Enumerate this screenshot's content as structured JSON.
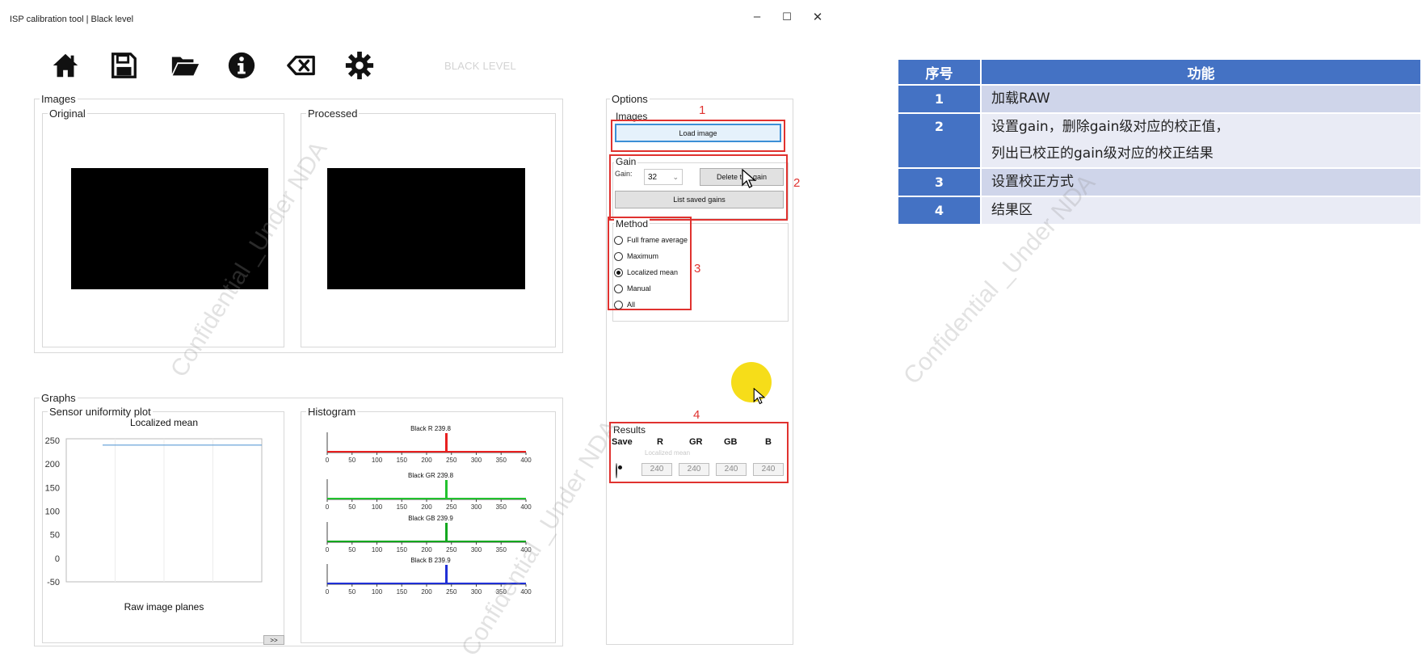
{
  "window": {
    "title": "ISP calibration tool | Black level",
    "minimize_glyph": "–",
    "maximize_glyph": "☐",
    "close_glyph": "✕"
  },
  "toolbar": {
    "icons": [
      "home-icon",
      "save-icon",
      "folder-open-icon",
      "info-icon",
      "backspace-icon",
      "gear-icon"
    ],
    "section_label": "BLACK LEVEL"
  },
  "images": {
    "legend": "Images",
    "original_legend": "Original",
    "processed_legend": "Processed"
  },
  "graphs": {
    "legend": "Graphs",
    "sensor_legend": "Sensor uniformity plot",
    "histogram_legend": "Histogram",
    "expand_button": ">>"
  },
  "options": {
    "legend": "Options",
    "images_legend": "Images",
    "load_image": "Load image",
    "gain_legend": "Gain",
    "gain_label": "Gain:",
    "gain_value": "32",
    "delete_gain": "Delete this gain",
    "list_saved_gains": "List saved gains",
    "method_legend": "Method",
    "methods": [
      {
        "label": "Full frame average",
        "selected": false
      },
      {
        "label": "Maximum",
        "selected": false
      },
      {
        "label": "Localized mean",
        "selected": true
      },
      {
        "label": "Manual",
        "selected": false
      },
      {
        "label": "All",
        "selected": false
      }
    ],
    "results_legend": "Results",
    "results_headers": [
      "Save",
      "R",
      "GR",
      "GB",
      "B"
    ],
    "results_method": "Localized mean",
    "results_values": [
      "240",
      "240",
      "240",
      "240"
    ],
    "save_selected": true
  },
  "annotations": [
    "1",
    "2",
    "3",
    "4"
  ],
  "table": {
    "headers": [
      "序号",
      "功能"
    ],
    "rows": [
      {
        "num": "1",
        "lines": [
          "加载RAW"
        ]
      },
      {
        "num": "2",
        "lines": [
          "设置gain，删除gain级对应的校正值，",
          "列出已校正的gain级对应的校正结果"
        ]
      },
      {
        "num": "3",
        "lines": [
          "设置校正方式"
        ]
      },
      {
        "num": "4",
        "lines": [
          "结果区"
        ]
      }
    ]
  },
  "watermark_text": "Confidential _Under NDA",
  "colors": {
    "accent_red": "#e0322f",
    "table_header": "#4472c4",
    "hist_r": "#e81f1f",
    "hist_gr": "#22c22e",
    "hist_gb": "#12a71e",
    "hist_b": "#1f2fd6"
  },
  "chart_data": [
    {
      "type": "line",
      "title": "Localized mean",
      "xlabel": "Raw image planes",
      "ylabel": "",
      "ylim": [
        -50,
        250
      ],
      "yticks": [
        "250",
        "200",
        "150",
        "100",
        "50",
        "0",
        "-50"
      ],
      "grid": true,
      "series": [
        {
          "values": [
            240,
            240,
            240,
            240
          ]
        }
      ]
    },
    {
      "type": "bar",
      "title": "Black R 239.8",
      "xlim": [
        0,
        400
      ],
      "xticks": [
        "0",
        "50",
        "100",
        "150",
        "200",
        "250",
        "300",
        "350",
        "400"
      ],
      "peak_x": 239.8,
      "color": "#e81f1f"
    },
    {
      "type": "bar",
      "title": "Black GR 239.8",
      "xlim": [
        0,
        400
      ],
      "xticks": [
        "0",
        "50",
        "100",
        "150",
        "200",
        "250",
        "300",
        "350",
        "400"
      ],
      "peak_x": 239.8,
      "color": "#22c22e"
    },
    {
      "type": "bar",
      "title": "Black GB 239.9",
      "xlim": [
        0,
        400
      ],
      "xticks": [
        "0",
        "50",
        "100",
        "150",
        "200",
        "250",
        "300",
        "350",
        "400"
      ],
      "peak_x": 239.9,
      "color": "#12a71e"
    },
    {
      "type": "bar",
      "title": "Black B 239.9",
      "xlim": [
        0,
        400
      ],
      "xticks": [
        "0",
        "50",
        "100",
        "150",
        "200",
        "250",
        "300",
        "350",
        "400"
      ],
      "peak_x": 239.9,
      "color": "#1f2fd6"
    }
  ]
}
